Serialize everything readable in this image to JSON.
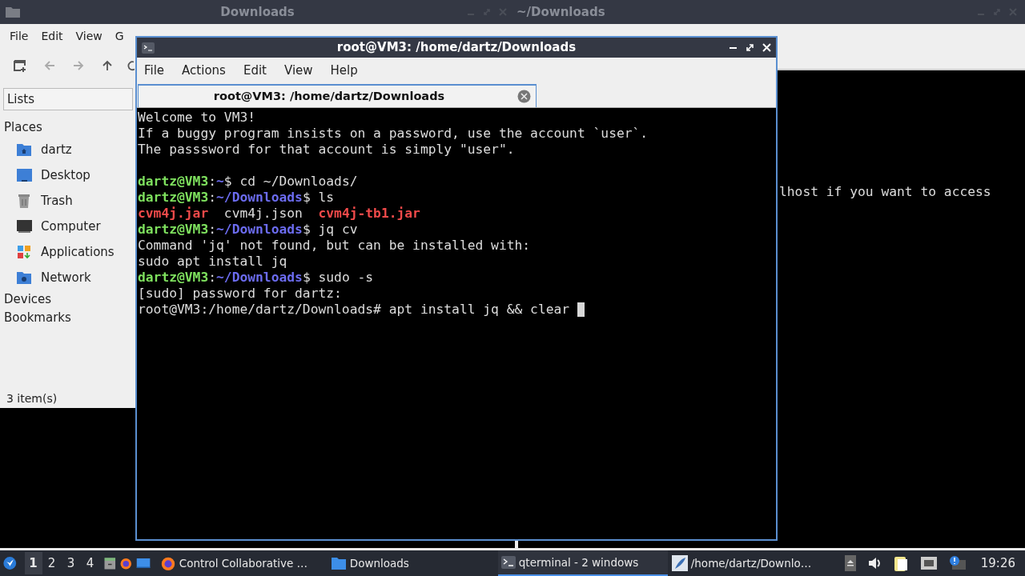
{
  "file_manager": {
    "title": "Downloads",
    "menu": [
      "File",
      "Edit",
      "View",
      "G"
    ],
    "side_pane_mode": "Lists",
    "sections": [
      {
        "label": "Places",
        "items": [
          {
            "label": "dartz",
            "kind": "home"
          },
          {
            "label": "Desktop",
            "kind": "desktop"
          },
          {
            "label": "Trash",
            "kind": "trash"
          },
          {
            "label": "Computer",
            "kind": "computer"
          },
          {
            "label": "Applications",
            "kind": "applications"
          },
          {
            "label": "Network",
            "kind": "network"
          }
        ]
      },
      {
        "label": "Devices"
      },
      {
        "label": "Bookmarks"
      }
    ],
    "status": "3 item(s)"
  },
  "background_terminal": {
    "title": "~/Downloads",
    "output": "lhost if you want to access"
  },
  "terminal": {
    "title": "root@VM3: /home/dartz/Downloads",
    "menu": [
      "File",
      "Actions",
      "Edit",
      "View",
      "Help"
    ],
    "tabs": [
      {
        "label": "root@VM3: /home/dartz/Downloads",
        "selected": true
      }
    ],
    "lines": [
      {
        "kind": "text",
        "segments": [
          {
            "kind": "plain",
            "text": "Welcome to VM3!"
          }
        ]
      },
      {
        "kind": "text",
        "segments": [
          {
            "kind": "plain",
            "text": "If a buggy program insists on a password, use the account `user`."
          }
        ]
      },
      {
        "kind": "text",
        "segments": [
          {
            "kind": "plain",
            "text": "The passsword for that account is simply \"user\"."
          }
        ]
      },
      {
        "kind": "blank"
      },
      {
        "kind": "text",
        "segments": [
          {
            "kind": "user",
            "text": "dartz@VM3"
          },
          {
            "kind": "plain",
            "text": ":"
          },
          {
            "kind": "path",
            "text": "~"
          },
          {
            "kind": "plain",
            "text": "$ cd ~/Downloads/"
          }
        ]
      },
      {
        "kind": "text",
        "segments": [
          {
            "kind": "user",
            "text": "dartz@VM3"
          },
          {
            "kind": "plain",
            "text": ":"
          },
          {
            "kind": "path",
            "text": "~/Downloads"
          },
          {
            "kind": "plain",
            "text": "$ ls"
          }
        ]
      },
      {
        "kind": "text",
        "segments": [
          {
            "kind": "archive",
            "text": "cvm4j.jar"
          },
          {
            "kind": "plain",
            "text": "  cvm4j.json  "
          },
          {
            "kind": "archive",
            "text": "cvm4j-tb1.jar"
          }
        ]
      },
      {
        "kind": "text",
        "segments": [
          {
            "kind": "user",
            "text": "dartz@VM3"
          },
          {
            "kind": "plain",
            "text": ":"
          },
          {
            "kind": "path",
            "text": "~/Downloads"
          },
          {
            "kind": "plain",
            "text": "$ jq cv"
          }
        ]
      },
      {
        "kind": "text",
        "segments": [
          {
            "kind": "plain",
            "text": "Command 'jq' not found, but can be installed with:"
          }
        ]
      },
      {
        "kind": "text",
        "segments": [
          {
            "kind": "plain",
            "text": "sudo apt install jq"
          }
        ]
      },
      {
        "kind": "text",
        "segments": [
          {
            "kind": "user",
            "text": "dartz@VM3"
          },
          {
            "kind": "plain",
            "text": ":"
          },
          {
            "kind": "path",
            "text": "~/Downloads"
          },
          {
            "kind": "plain",
            "text": "$ sudo -s"
          }
        ]
      },
      {
        "kind": "text",
        "segments": [
          {
            "kind": "plain",
            "text": "[sudo] password for dartz:"
          }
        ]
      },
      {
        "kind": "text",
        "segments": [
          {
            "kind": "plain",
            "text": "root@VM3:/home/dartz/Downloads# apt install jq && clear "
          }
        ]
      }
    ],
    "cursor": true
  },
  "taskbar": {
    "workspaces": [
      {
        "label": "1",
        "selected": true
      },
      {
        "label": "2",
        "selected": false
      },
      {
        "label": "3",
        "selected": false
      },
      {
        "label": "4",
        "selected": false
      }
    ],
    "tasks": [
      {
        "label": "Control Collaborative …",
        "kind": "browser",
        "selected": false
      },
      {
        "label": "Downloads",
        "kind": "folder",
        "selected": false
      },
      {
        "label": "qterminal - 2 windows",
        "kind": "terminal",
        "selected": true
      },
      {
        "label": "/home/dartz/Downlo…",
        "kind": "editor",
        "selected": false
      }
    ],
    "clock": "19:26"
  }
}
